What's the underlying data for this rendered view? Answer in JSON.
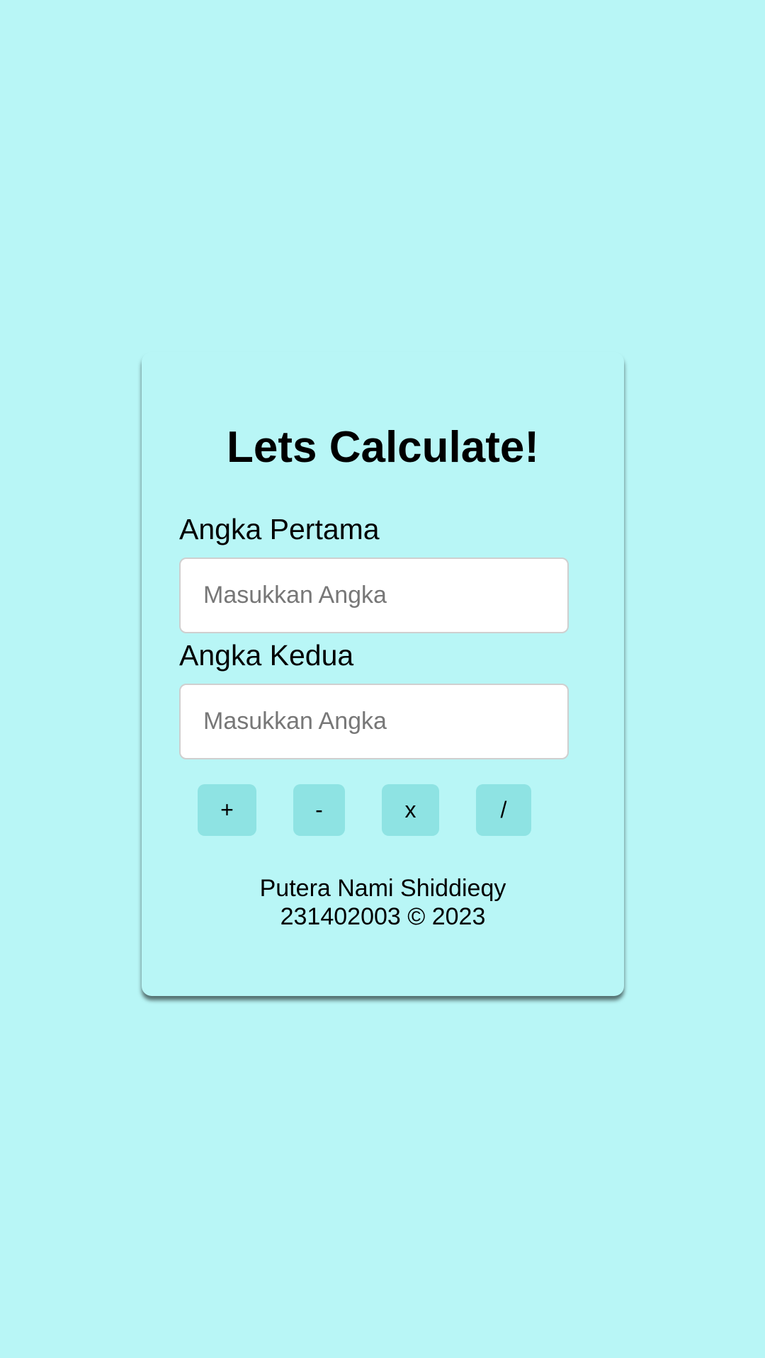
{
  "colors": {
    "background": "#b8f6f6",
    "card": "#b8f6f6",
    "button": "#8ee3e3",
    "input_background": "#ffffff",
    "placeholder": "#777777"
  },
  "card": {
    "title": "Lets Calculate!",
    "fields": [
      {
        "label": "Angka Pertama",
        "placeholder": "Masukkan Angka",
        "value": ""
      },
      {
        "label": "Angka Kedua",
        "placeholder": "Masukkan Angka",
        "value": ""
      }
    ],
    "operators": [
      {
        "label": "+",
        "icon": "plus-icon"
      },
      {
        "label": "-",
        "icon": "minus-icon"
      },
      {
        "label": "x",
        "icon": "multiply-icon"
      },
      {
        "label": "/",
        "icon": "divide-icon"
      }
    ],
    "footer": {
      "name": "Putera Nami Shiddieqy",
      "id_copyright": "231402003 © 2023"
    }
  }
}
